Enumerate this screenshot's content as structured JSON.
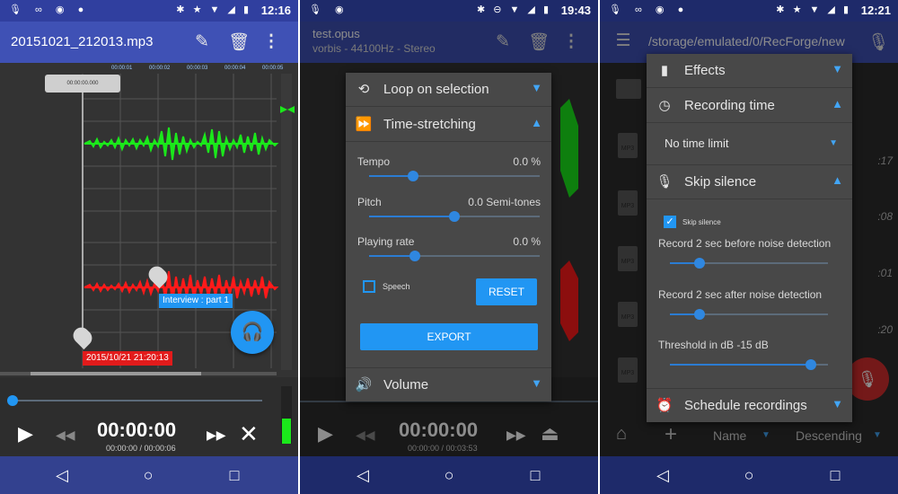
{
  "colors": {
    "accent": "#2196f3",
    "toolbar": "#3f51b5",
    "navbar": "#33418f",
    "wave_left": "#1be81b",
    "wave_right": "#ff1a1a",
    "marker": "#e21b1b"
  },
  "phone1": {
    "status": {
      "time": "12:16",
      "h": "H"
    },
    "title": "20151021_212013.mp3",
    "icons": [
      "edit-icon",
      "delete-icon",
      "more-vert-icon"
    ],
    "ruler_ticks": [
      "00:00:01",
      "00:00:02",
      "00:00:03",
      "00:00:04",
      "00:00:05"
    ],
    "cursor_time": "00:00:00.000",
    "markers": [
      {
        "label": "Interview : part 1"
      },
      {
        "label": "2015/10/21 21:20:13"
      }
    ],
    "time_main": "00:00:00",
    "time_sub": "00:00:00 / 00:00:06",
    "playhead_fraction": 0.0
  },
  "phone2": {
    "status": {
      "time": "19:43"
    },
    "title": "test.opus",
    "subtitle": "vorbis - 44100Hz - Stereo",
    "menu": {
      "loop": "Loop on selection",
      "timestretch": "Time-stretching",
      "tempo_label": "Tempo",
      "tempo_value": "0.0 %",
      "tempo_fraction": 0.26,
      "pitch_label": "Pitch",
      "pitch_value": "0.0 Semi-tones",
      "pitch_fraction": 0.5,
      "rate_label": "Playing rate",
      "rate_value": "0.0 %",
      "rate_fraction": 0.27,
      "speech_label": "Speech",
      "reset_label": "RESET",
      "export_label": "EXPORT",
      "volume": "Volume"
    },
    "time_main": "00:00:00",
    "time_sub": "00:00:00 / 00:03:53"
  },
  "phone3": {
    "status": {
      "time": "12:21",
      "h": "H"
    },
    "path": "/storage/emulated/0/RecForge/new",
    "menu": {
      "effects": "Effects",
      "recording_time": "Recording time",
      "no_limit": "No time limit",
      "skip_silence": "Skip silence",
      "skip_silence_check": "Skip silence",
      "before_label": "Record 2 sec before noise detection",
      "before_fraction": 0.19,
      "after_label": "Record 2 sec after noise detection",
      "after_fraction": 0.19,
      "threshold_label": "Threshold in dB -15 dB",
      "threshold_fraction": 0.89,
      "schedule": "Schedule recordings"
    },
    "file_times": [
      ":17",
      ":08",
      ":01",
      ":20"
    ],
    "file_type": "MP3",
    "bottom": {
      "sort": "Name",
      "order": "Descending"
    }
  }
}
